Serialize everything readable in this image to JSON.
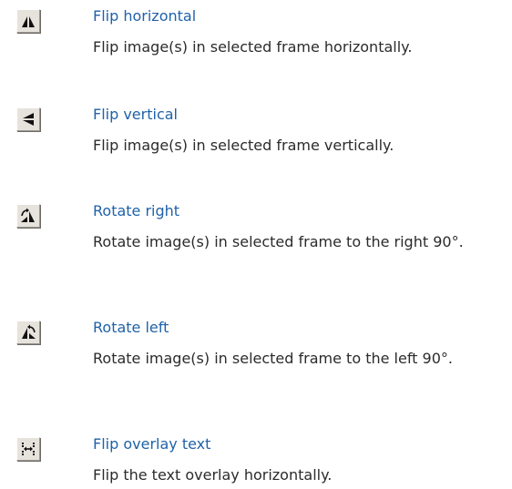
{
  "items": [
    {
      "icon": "flip-horizontal-icon",
      "title": "Flip horizontal",
      "description": "Flip image(s) in selected frame horizontally."
    },
    {
      "icon": "flip-vertical-icon",
      "title": "Flip vertical",
      "description": "Flip image(s) in selected frame vertically."
    },
    {
      "icon": "rotate-right-icon",
      "title": "Rotate right",
      "description": "Rotate image(s) in selected frame to the right 90°."
    },
    {
      "icon": "rotate-left-icon",
      "title": "Rotate left",
      "description": "Rotate image(s) in selected frame to the left 90°."
    },
    {
      "icon": "flip-overlay-text-icon",
      "title": "Flip overlay text",
      "description": "Flip the text overlay horizontally."
    }
  ],
  "colors": {
    "title": "#1f62a8",
    "text": "#2b2b2b",
    "icon_face": "#e6e3dc"
  }
}
